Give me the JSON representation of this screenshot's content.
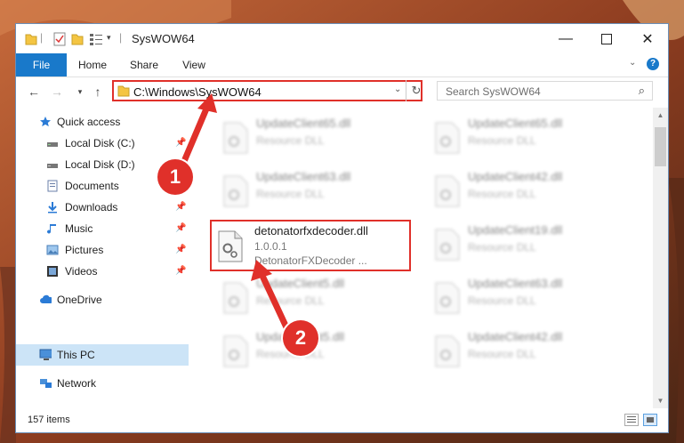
{
  "window": {
    "title": "SysWOW64"
  },
  "ribbon": {
    "tabs": [
      {
        "label": "File"
      },
      {
        "label": "Home"
      },
      {
        "label": "Share"
      },
      {
        "label": "View"
      }
    ]
  },
  "address": {
    "path": "C:\\Windows\\SysWOW64"
  },
  "search": {
    "placeholder": "Search SysWOW64"
  },
  "sidebar": {
    "items": [
      {
        "label": "Quick access",
        "icon": "star-icon"
      },
      {
        "label": "Local Disk (C:)",
        "icon": "drive-icon"
      },
      {
        "label": "Local Disk (D:)",
        "icon": "drive-icon"
      },
      {
        "label": "Documents",
        "icon": "documents-icon"
      },
      {
        "label": "Downloads",
        "icon": "download-icon"
      },
      {
        "label": "Music",
        "icon": "music-icon"
      },
      {
        "label": "Pictures",
        "icon": "pictures-icon"
      },
      {
        "label": "Videos",
        "icon": "videos-icon"
      },
      {
        "label": "OneDrive",
        "icon": "cloud-icon"
      },
      {
        "label": "This PC",
        "icon": "computer-icon"
      },
      {
        "label": "Network",
        "icon": "network-icon"
      }
    ]
  },
  "files": {
    "highlighted": {
      "name": "detonatorfxdecoder.dll",
      "version": "1.0.0.1",
      "description": "DetonatorFXDecoder ..."
    },
    "blurred": [
      {
        "name": "UpdateClient65.dll",
        "type": "Resource DLL"
      },
      {
        "name": "UpdateClient65.dll",
        "type": "Resource DLL"
      },
      {
        "name": "UpdateClient63.dll",
        "type": "Resource DLL"
      },
      {
        "name": "UpdateClient42.dll",
        "type": "Resource DLL"
      },
      {
        "name": "UpdateClient19.dll",
        "type": "Resource DLL"
      },
      {
        "name": "UpdateClient5.dll",
        "type": "Resource DLL"
      },
      {
        "name": "UpdateClient63.dll",
        "type": "Resource DLL"
      },
      {
        "name": "UpdateClient5.dll",
        "type": "Resource DLL"
      },
      {
        "name": "UpdateClient42.dll",
        "type": "Resource DLL"
      }
    ]
  },
  "status": {
    "item_count": "157 items"
  },
  "callouts": {
    "one": "1",
    "two": "2"
  },
  "colors": {
    "accent": "#1979ca",
    "callout": "#e0302a",
    "selected": "#cce4f7"
  }
}
